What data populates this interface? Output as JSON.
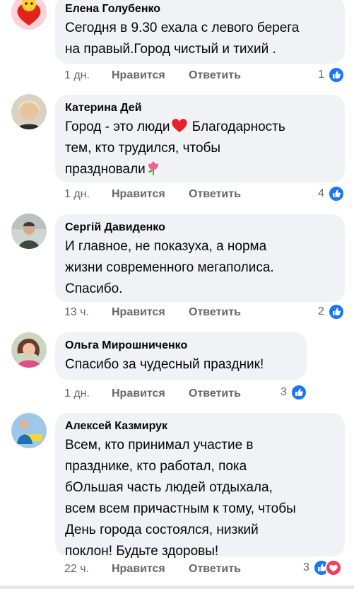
{
  "comments": [
    {
      "author": "Елена Голубенко",
      "text": "Сегодня в 9.30 ехала с левого берега\nна правый.Город чистый и тихий .",
      "time": "1 дн.",
      "reaction_count": "1"
    },
    {
      "author": "Катерина Дей",
      "text_1": "Город - это люди",
      "text_2": " Благодарность\nтем, кто трудился, чтобы\nпраздновали",
      "time": "1 дн.",
      "reaction_count": "4"
    },
    {
      "author": "Сергій Давиденко",
      "text": "И главное, не показуха, а норма\nжизни современного мегаполиса.\nСпасибо.",
      "time": "13 ч.",
      "reaction_count": "2"
    },
    {
      "author": "Ольга Мирошниченко",
      "text": "Спасибо за чудесный праздник!",
      "time": "1 дн.",
      "reaction_count": "3"
    },
    {
      "author": "Алексей Казмирук",
      "text": "Всем, кто принимал участие в\nпразднике, кто работал, пока\nбОльшая часть людей отдыхала,\nвсем всем причастным к тому, чтобы\nДень города состоялся, низкий\nпоклон! Будьте здоровы!",
      "time": "22 ч.",
      "reaction_count": "3"
    }
  ],
  "actions": {
    "like_label": "Нравится",
    "reply_label": "Ответить"
  },
  "icons": {
    "like": "thumbs-up-icon",
    "love": "heart-icon",
    "emoji_heart": "red-heart-emoji",
    "emoji_tulip": "tulip-emoji"
  },
  "colors": {
    "bubble": "#f0f2f5",
    "meta_text": "#65676b",
    "like_blue": "#1877f2",
    "love_red": "#f33e58"
  }
}
